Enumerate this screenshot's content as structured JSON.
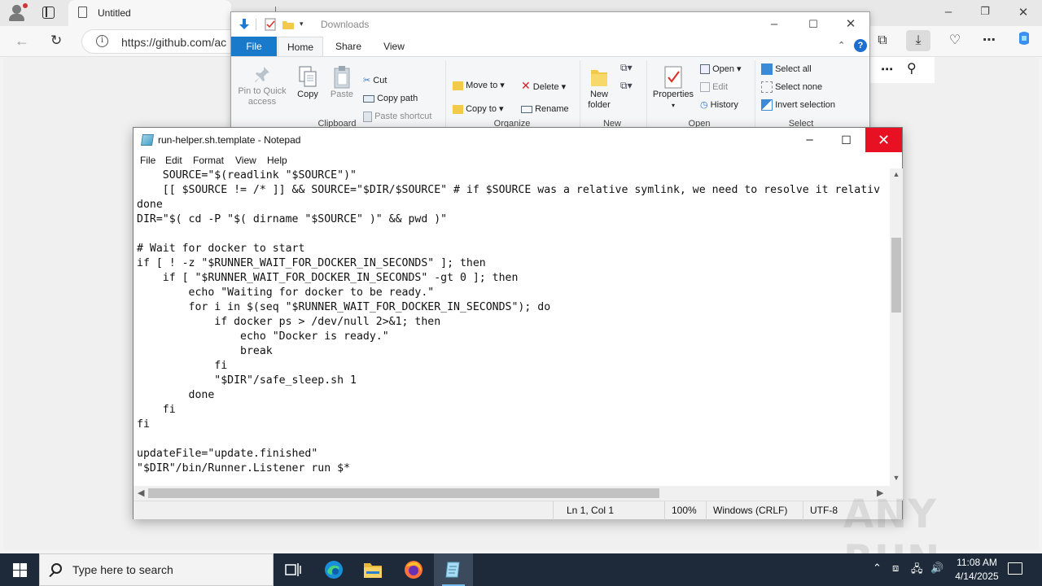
{
  "edge": {
    "tab_title": "Untitled",
    "url": "https://github.com/ac",
    "back_icon": "back-arrow-icon",
    "refresh_icon": "refresh-icon"
  },
  "explorer": {
    "title": "Downloads",
    "tabs": {
      "file": "File",
      "home": "Home",
      "share": "Share",
      "view": "View"
    },
    "clipboard": {
      "label": "Clipboard",
      "pin": "Pin to Quick access",
      "copy": "Copy",
      "paste": "Paste",
      "cut": "Cut",
      "copy_path": "Copy path",
      "paste_shortcut": "Paste shortcut"
    },
    "organize": {
      "label": "Organize",
      "move_to": "Move to",
      "copy_to": "Copy to",
      "delete": "Delete",
      "rename": "Rename"
    },
    "new": {
      "label": "New",
      "new_folder": "New folder"
    },
    "open": {
      "label": "Open",
      "properties": "Properties",
      "open": "Open",
      "edit": "Edit",
      "history": "History"
    },
    "select": {
      "label": "Select",
      "select_all": "Select all",
      "select_none": "Select none",
      "invert_selection": "Invert selection"
    }
  },
  "notepad": {
    "title": "run-helper.sh.template - Notepad",
    "menu": {
      "file": "File",
      "edit": "Edit",
      "format": "Format",
      "view": "View",
      "help": "Help"
    },
    "content": "    SOURCE=\"$(readlink \"$SOURCE\")\"\n    [[ $SOURCE != /* ]] && SOURCE=\"$DIR/$SOURCE\" # if $SOURCE was a relative symlink, we need to resolve it relativ\ndone\nDIR=\"$( cd -P \"$( dirname \"$SOURCE\" )\" && pwd )\"\n\n# Wait for docker to start\nif [ ! -z \"$RUNNER_WAIT_FOR_DOCKER_IN_SECONDS\" ]; then\n    if [ \"$RUNNER_WAIT_FOR_DOCKER_IN_SECONDS\" -gt 0 ]; then\n        echo \"Waiting for docker to be ready.\"\n        for i in $(seq \"$RUNNER_WAIT_FOR_DOCKER_IN_SECONDS\"); do\n            if docker ps > /dev/null 2>&1; then\n                echo \"Docker is ready.\"\n                break\n            fi\n            \"$DIR\"/safe_sleep.sh 1\n        done\n    fi\nfi\n\nupdateFile=\"update.finished\"\n\"$DIR\"/bin/Runner.Listener run $*",
    "status": {
      "position": "Ln 1, Col 1",
      "zoom": "100%",
      "line_ending": "Windows (CRLF)",
      "encoding": "UTF-8"
    }
  },
  "watermark": "ANY RUN",
  "taskbar": {
    "search_placeholder": "Type here to search",
    "time": "11:08 AM",
    "date": "4/14/2025"
  },
  "colors": {
    "explorer_file_tab": "#1979ca",
    "notepad_close": "#e81123",
    "taskbar": "#1e2a3a"
  }
}
